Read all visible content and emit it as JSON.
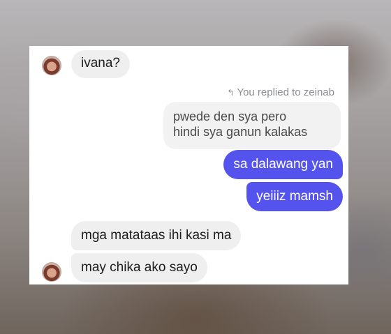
{
  "thread": {
    "reply_icon": "reply-arrow-icon",
    "reply_note": "You replied to zeinab",
    "messages": [
      {
        "from": "them",
        "text": "ivana?"
      },
      {
        "from": "quoted",
        "line1": "pwede den sya pero",
        "line2": "hindi sya ganun kalakas"
      },
      {
        "from": "me",
        "text": "sa dalawang yan"
      },
      {
        "from": "me",
        "text": "yeiiiz mamsh"
      },
      {
        "from": "them",
        "text": "mga matataas ihi kasi ma"
      },
      {
        "from": "them",
        "text": "may chika ako sayo"
      }
    ]
  },
  "colors": {
    "outgoing_bubble": "#5553ee",
    "incoming_bubble": "#efeff0",
    "meta_text": "#8a8d91"
  }
}
